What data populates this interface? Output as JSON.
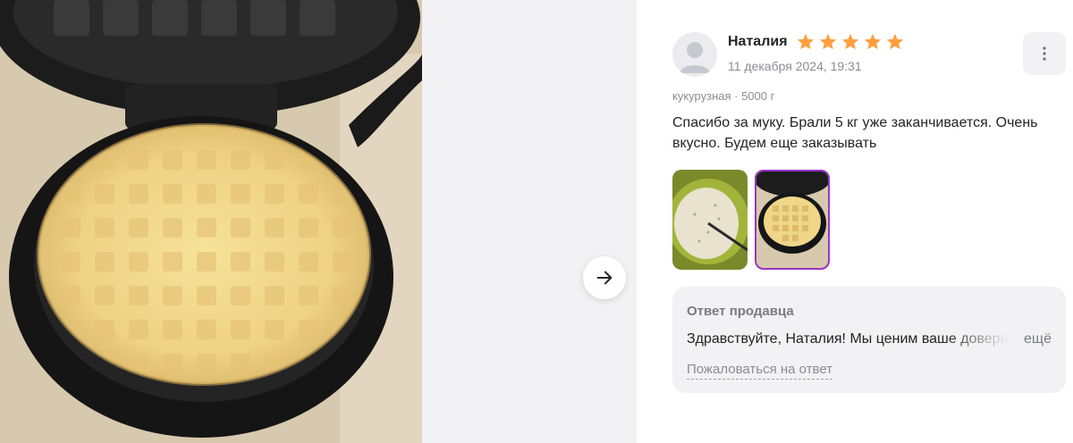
{
  "viewer": {
    "next_icon": "arrow-right-icon"
  },
  "review": {
    "author": "Наталия",
    "rating": 5,
    "rating_max": 5,
    "date": "11 декабря 2024, 19:31",
    "variant": "кукурузная · 5000 г",
    "text": "Спасибо за муку. Брали 5 кг уже заканчивается. Очень вкусно. Будем еще заказывать",
    "more_icon": "more-vertical-icon",
    "thumbnails": [
      {
        "icon": "photo-batter-thumbnail",
        "active": false
      },
      {
        "icon": "photo-waffle-thumbnail",
        "active": true
      }
    ]
  },
  "seller_answer": {
    "title": "Ответ продавца",
    "text": "Здравствуйте, Наталия! Мы ценим ваше доверие",
    "more_label": "ещё",
    "complain_label": "Пожаловаться на ответ"
  },
  "colors": {
    "star": "#ff9f40",
    "accent": "#9b34c7",
    "muted": "#8b8b95",
    "panel_bg": "#f2f2f5"
  }
}
